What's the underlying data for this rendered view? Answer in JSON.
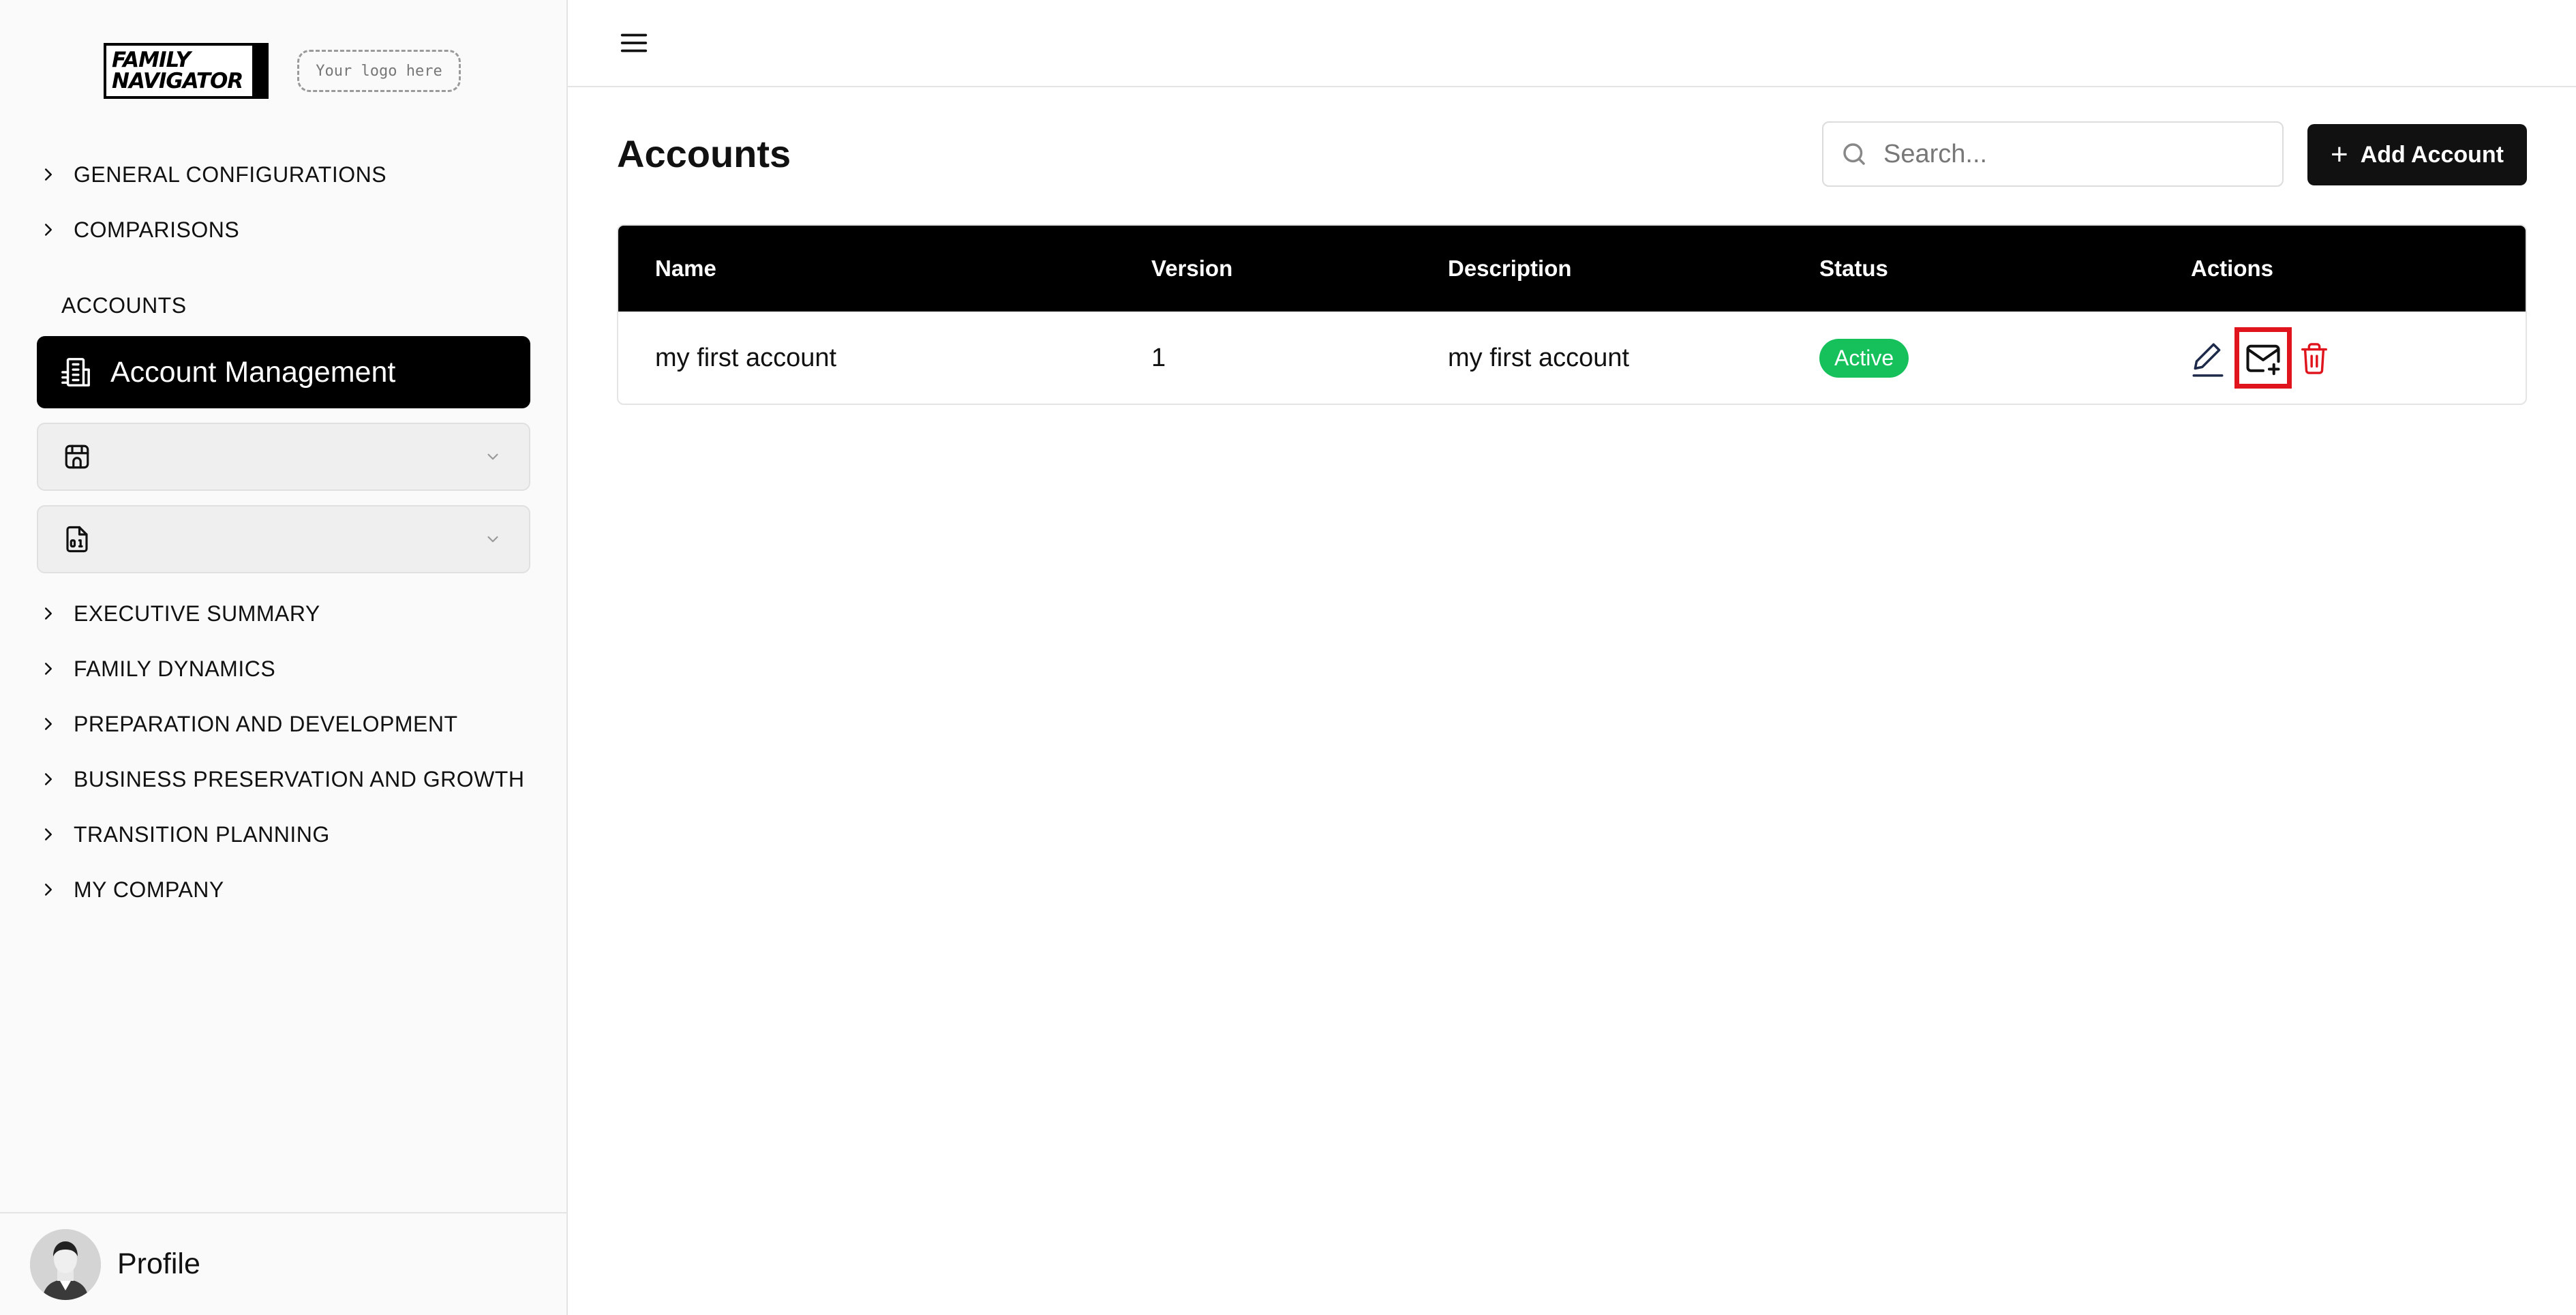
{
  "brand": {
    "logo_line1": "FAMILY",
    "logo_line2": "NAVIGATOR",
    "placeholder_logo": "Your logo here"
  },
  "sidebar": {
    "top_items": [
      {
        "label": "GENERAL CONFIGURATIONS"
      },
      {
        "label": "COMPARISONS"
      }
    ],
    "section_label": "ACCOUNTS",
    "active_item": {
      "label": "Account Management",
      "icon": "building-icon"
    },
    "collapsed_items": [
      {
        "icon": "store-icon",
        "label": ""
      },
      {
        "icon": "binary-file-icon",
        "label": ""
      }
    ],
    "bottom_items": [
      {
        "label": "EXECUTIVE SUMMARY"
      },
      {
        "label": "FAMILY DYNAMICS"
      },
      {
        "label": "PREPARATION AND DEVELOPMENT"
      },
      {
        "label": "BUSINESS PRESERVATION AND GROWTH"
      },
      {
        "label": "TRANSITION PLANNING"
      },
      {
        "label": "MY COMPANY"
      }
    ],
    "profile_label": "Profile"
  },
  "main": {
    "title": "Accounts",
    "search": {
      "placeholder": "Search...",
      "value": ""
    },
    "add_button_label": "Add Account",
    "table": {
      "columns": [
        "Name",
        "Version",
        "Description",
        "Status",
        "Actions"
      ],
      "rows": [
        {
          "name": "my first account",
          "version": "1",
          "description": "my first account",
          "status": "Active"
        }
      ]
    }
  },
  "colors": {
    "accent": "#000000",
    "status_active": "#16c15c",
    "delete": "#e0141c",
    "highlight": "#e0141c"
  }
}
